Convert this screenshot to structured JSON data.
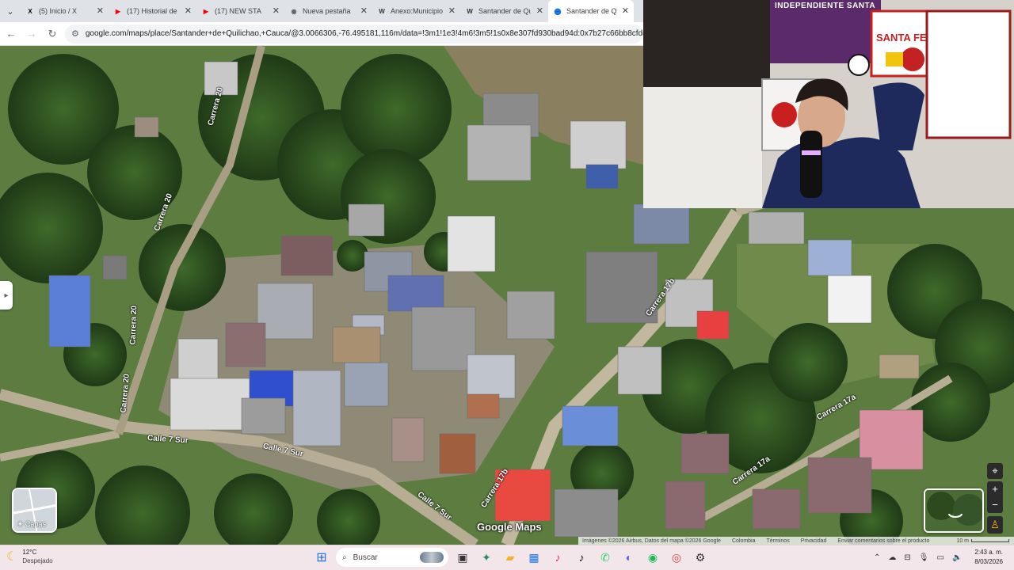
{
  "browser": {
    "tabs": [
      {
        "title": "(5) Inicio / X",
        "icon": "x-logo-icon",
        "color": "#000000",
        "glyph": "X",
        "active": false
      },
      {
        "title": "(17) Historial de r",
        "icon": "youtube-icon",
        "color": "#ff0000",
        "glyph": "▶",
        "active": false
      },
      {
        "title": "(17) NEW STA",
        "icon": "youtube-icon",
        "color": "#ff0000",
        "glyph": "▶",
        "active": false
      },
      {
        "title": "Nueva pestaña",
        "icon": "chrome-icon",
        "color": "#5f6368",
        "glyph": "◉",
        "active": false
      },
      {
        "title": "Anexo:Municipios",
        "icon": "wikipedia-icon",
        "color": "#333333",
        "glyph": "W",
        "active": false
      },
      {
        "title": "Santander de Qu",
        "icon": "wikipedia-icon",
        "color": "#333333",
        "glyph": "W",
        "active": false
      },
      {
        "title": "Santander de Qu",
        "icon": "maps-pin-icon",
        "color": "#1a73e8",
        "glyph": "⬤",
        "active": true
      }
    ],
    "url": "google.com/maps/place/Santander+de+Quilichao,+Cauca/@3.0066306,-76.495181,116m/data=!3m1!1e3!4m6!3m5!1s0x8e307fd930bad94d:0x7b27c66bb8cfddd2!8m2!3d3"
  },
  "map": {
    "road_labels": {
      "carrera20_a": "Carrera 20",
      "carrera20_b": "Carrera 20",
      "carrera20_c": "Carrera 20",
      "carrera20_d": "Carrera 20",
      "calle7sur_a": "Calle 7 Sur",
      "calle7sur_b": "Calle 7 Sur",
      "calle7sur_c": "Calle 7 Sur",
      "carrera17b_a": "Carrera 17b",
      "carrera17b_b": "Carrera 17b",
      "carrera17a_a": "Carrera 17a",
      "carrera17a_b": "Carrera 17a"
    },
    "layers_label": "Capas",
    "watermark": "Google Maps",
    "attribution": "Imágenes ©2026 Airbus, Datos del mapa ©2026 Google",
    "attribution_links": [
      "Colombia",
      "Términos",
      "Privacidad",
      "Enviar comentarios sobre el producto"
    ],
    "scale": "10 m"
  },
  "webcam": {
    "flag_text": "INDEPENDIENTE SANTA",
    "logo_text": "SANTA FE"
  },
  "taskbar": {
    "temperature": "12°C",
    "condition": "Despejado",
    "search_placeholder": "Buscar",
    "time": "2:43 a. m.",
    "date": "8/03/2026"
  }
}
